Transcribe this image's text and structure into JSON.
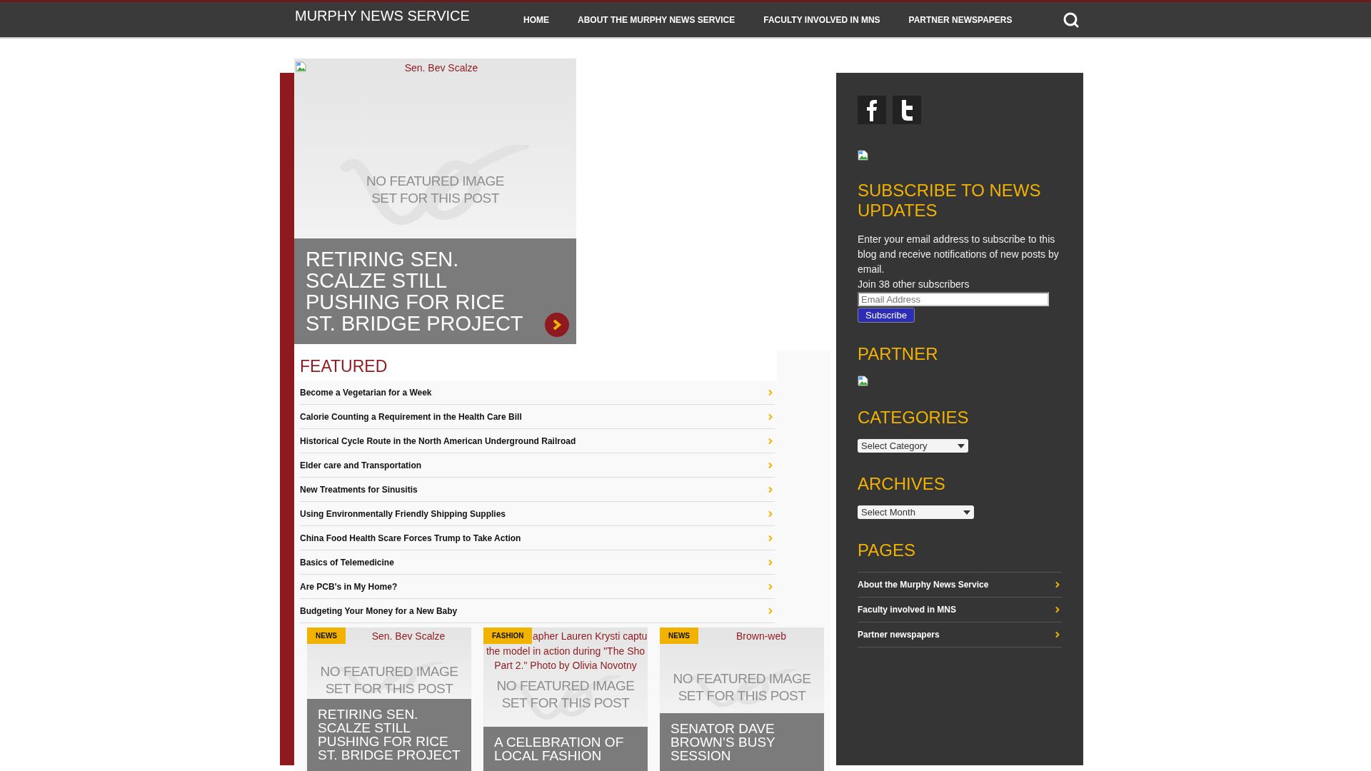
{
  "site_title": "MURPHY NEWS SERVICE",
  "nav": [
    {
      "label": "HOME"
    },
    {
      "label": "ABOUT THE MURPHY NEWS SERVICE"
    },
    {
      "label": "FACULTY INVOLVED IN MNS"
    },
    {
      "label": "PARTNER NEWSPAPERS"
    }
  ],
  "hero": {
    "image_alt": "Sen. Bev Scalze",
    "placeholder_text": [
      "NO FEATURED IMAGE",
      "SET FOR THIS POST"
    ],
    "title": "RETIRING SEN. SCALZE STILL PUSHING FOR RICE ST. BRIDGE PROJECT"
  },
  "featured": {
    "heading": "FEATURED",
    "items": [
      "Become a Vegetarian for a Week",
      "Calorie Counting a Requirement in the Health Care Bill",
      "Historical Cycle Route in the North American Underground Railroad",
      "Elder care and Transportation",
      "New Treatments for Sinusitis",
      "Using Environmentally Friendly Shipping Supplies",
      "China Food Health Scare Forces Trump to Take Action",
      "Basics of Telemedicine",
      "Are PCB's in My Home?",
      "Budgeting Your Money for a New Baby"
    ]
  },
  "cards": [
    {
      "category": "NEWS",
      "image_alt": [
        "Sen. Bev Scalze"
      ],
      "placeholder_text": [
        "NO FEATURED IMAGE",
        "SET FOR THIS POST"
      ],
      "title": "RETIRING SEN. SCALZE STILL PUSHING FOR RICE ST. BRIDGE PROJECT"
    },
    {
      "category": "FASHION",
      "image_alt": [
        "apher Lauren Krysti captu",
        "the model in action during \"The Sho",
        "Part 2.\" Photo by Olivia Novotny"
      ],
      "placeholder_text": [
        "NO FEATURED IMAGE",
        "SET FOR THIS POST"
      ],
      "title": "A CELEBRATION OF LOCAL FASHION"
    },
    {
      "category": "NEWS",
      "image_alt": [
        "Brown-web"
      ],
      "placeholder_text": [
        "NO FEATURED IMAGE",
        "SET FOR THIS POST"
      ],
      "title": "SENATOR DAVE BROWN’S BUSY SESSION"
    }
  ],
  "sidebar": {
    "subscribe": {
      "heading": "SUBSCRIBE TO NEWS UPDATES",
      "text": "Enter your email address to subscribe to this blog and receive notifications of new posts by email.",
      "count": "Join 38 other subscribers",
      "placeholder": "Email Address",
      "button": "Subscribe"
    },
    "partner": {
      "heading": "PARTNER"
    },
    "categories": {
      "heading": "CATEGORIES",
      "select": "Select Category"
    },
    "archives": {
      "heading": "ARCHIVES",
      "select": "Select Month"
    },
    "pages": {
      "heading": "PAGES",
      "items": [
        "About the Murphy News Service",
        "Faculty involved in MNS",
        "Partner newspapers"
      ]
    }
  }
}
